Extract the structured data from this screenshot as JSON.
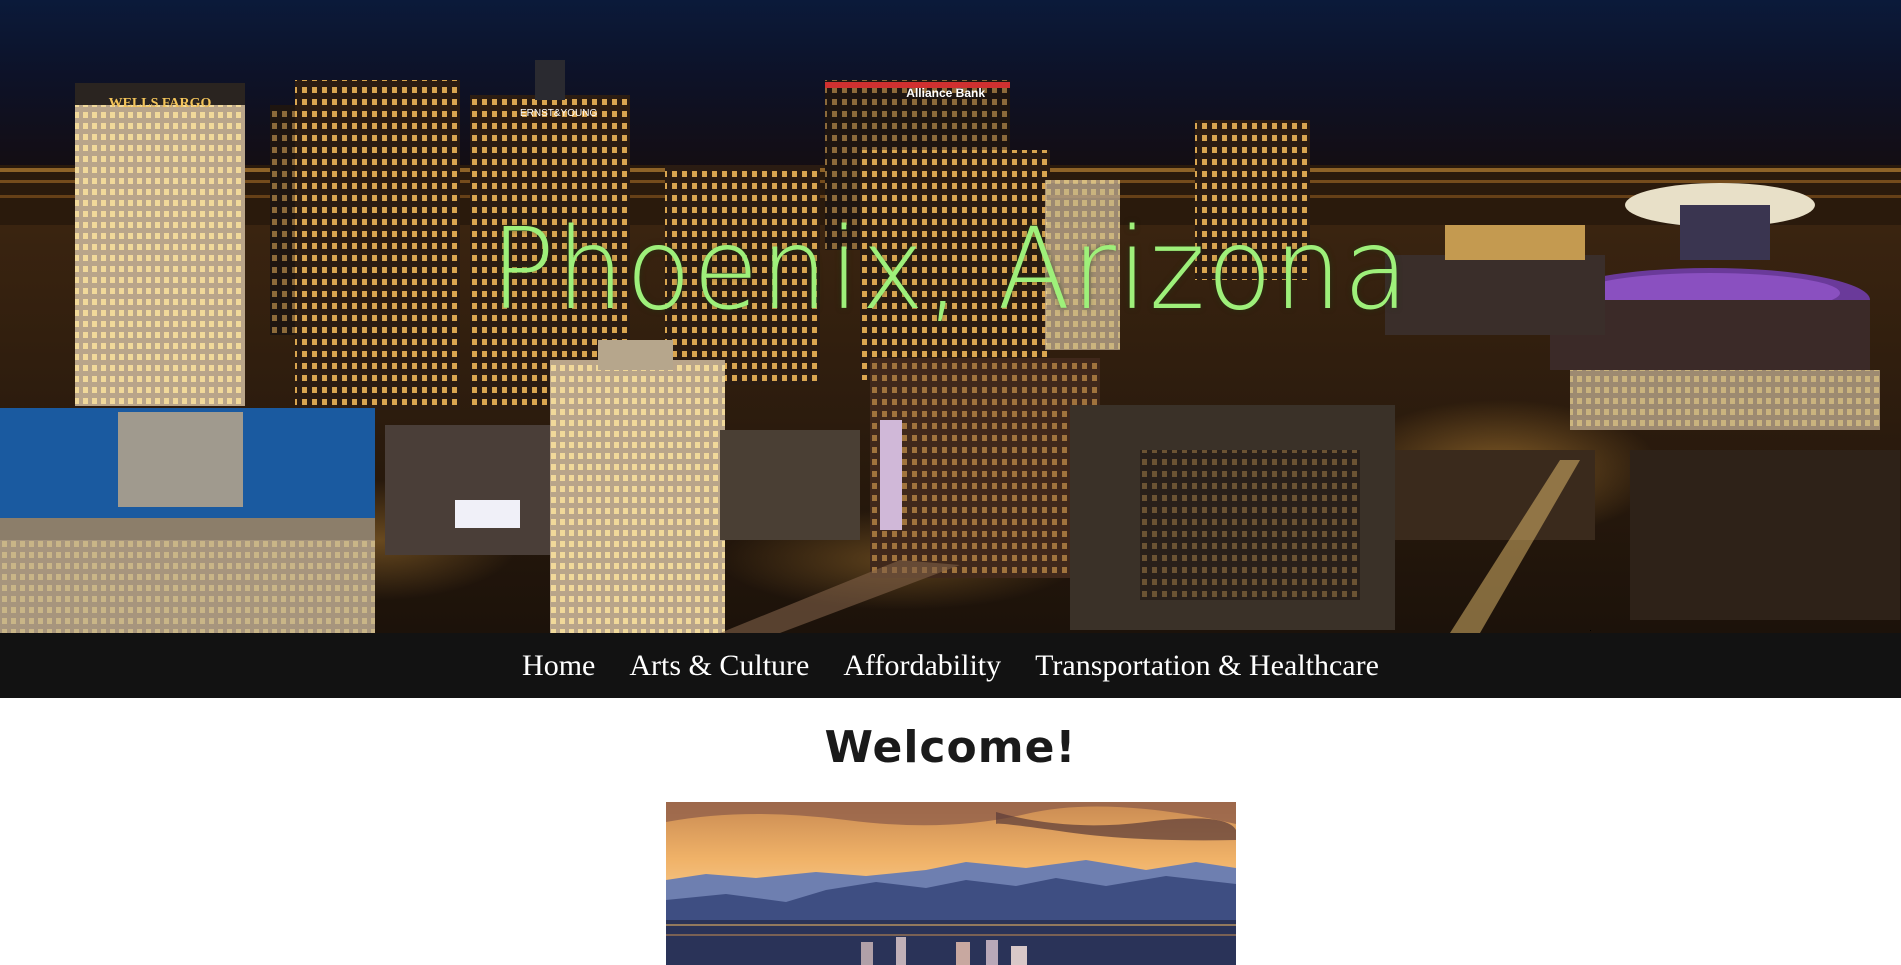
{
  "hero": {
    "title": "Phoenix, Arizona",
    "image_desc_colors": {
      "sky": "#0a1530",
      "title_color": "#9ef07a"
    },
    "signs": {
      "wells_fargo": "WELLS FARGO",
      "ernst_young": "ERNST&YOUNG",
      "alliance_bank": "Alliance Bank"
    }
  },
  "nav": {
    "items": [
      {
        "label": "Home"
      },
      {
        "label": "Arts & Culture"
      },
      {
        "label": "Affordability"
      },
      {
        "label": "Transportation & Healthcare"
      }
    ],
    "background": "#121212"
  },
  "main": {
    "heading": "Welcome!"
  }
}
